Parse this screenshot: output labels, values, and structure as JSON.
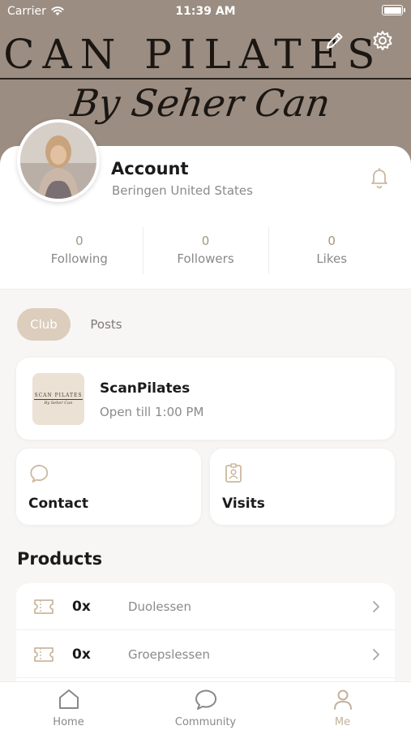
{
  "status_bar": {
    "carrier": "Carrier",
    "time": "11:39 AM"
  },
  "cover": {
    "title": "SCAN PILATES",
    "subtitle": "By Seher Can"
  },
  "profile": {
    "name": "Account",
    "location": "Beringen United States"
  },
  "stats": [
    {
      "value": "0",
      "label": "Following"
    },
    {
      "value": "0",
      "label": "Followers"
    },
    {
      "value": "0",
      "label": "Likes"
    }
  ],
  "tabs": [
    {
      "label": "Club",
      "active": true
    },
    {
      "label": "Posts",
      "active": false
    }
  ],
  "club": {
    "name": "ScanPilates",
    "hours": "Open till 1:00 PM",
    "logo_line1": "SCAN PILATES",
    "logo_line2": "By Seher Can"
  },
  "actions": {
    "contact_label": "Contact",
    "visits_label": "Visits"
  },
  "products": {
    "title": "Products",
    "items": [
      {
        "qty": "0x",
        "name": "Duolessen"
      },
      {
        "qty": "0x",
        "name": "Groepslessen"
      },
      {
        "qty": "",
        "name": ""
      }
    ]
  },
  "tab_bar": {
    "items": [
      {
        "label": "Home",
        "icon": "home-icon",
        "active": false
      },
      {
        "label": "Community",
        "icon": "chat-icon",
        "active": false
      },
      {
        "label": "Me",
        "icon": "person-icon",
        "active": true
      }
    ]
  },
  "colors": {
    "accent": "#c4b19c",
    "accent_pill": "#dccdbd",
    "cover_bg": "#9b8d82",
    "icon_tan": "#cdb79f"
  }
}
